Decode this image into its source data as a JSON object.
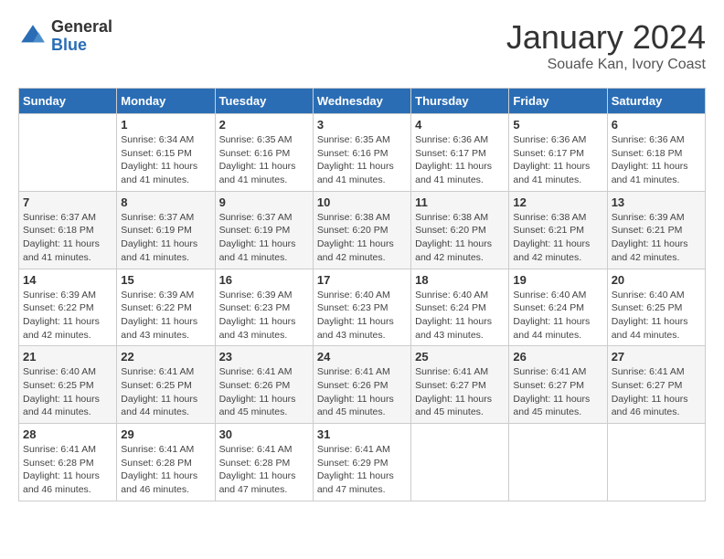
{
  "logo": {
    "general": "General",
    "blue": "Blue"
  },
  "title": {
    "month": "January 2024",
    "location": "Souafe Kan, Ivory Coast"
  },
  "weekdays": [
    "Sunday",
    "Monday",
    "Tuesday",
    "Wednesday",
    "Thursday",
    "Friday",
    "Saturday"
  ],
  "weeks": [
    [
      {
        "day": "",
        "info": ""
      },
      {
        "day": "1",
        "info": "Sunrise: 6:34 AM\nSunset: 6:15 PM\nDaylight: 11 hours and 41 minutes."
      },
      {
        "day": "2",
        "info": "Sunrise: 6:35 AM\nSunset: 6:16 PM\nDaylight: 11 hours and 41 minutes."
      },
      {
        "day": "3",
        "info": "Sunrise: 6:35 AM\nSunset: 6:16 PM\nDaylight: 11 hours and 41 minutes."
      },
      {
        "day": "4",
        "info": "Sunrise: 6:36 AM\nSunset: 6:17 PM\nDaylight: 11 hours and 41 minutes."
      },
      {
        "day": "5",
        "info": "Sunrise: 6:36 AM\nSunset: 6:17 PM\nDaylight: 11 hours and 41 minutes."
      },
      {
        "day": "6",
        "info": "Sunrise: 6:36 AM\nSunset: 6:18 PM\nDaylight: 11 hours and 41 minutes."
      }
    ],
    [
      {
        "day": "7",
        "info": "Sunrise: 6:37 AM\nSunset: 6:18 PM\nDaylight: 11 hours and 41 minutes."
      },
      {
        "day": "8",
        "info": "Sunrise: 6:37 AM\nSunset: 6:19 PM\nDaylight: 11 hours and 41 minutes."
      },
      {
        "day": "9",
        "info": "Sunrise: 6:37 AM\nSunset: 6:19 PM\nDaylight: 11 hours and 41 minutes."
      },
      {
        "day": "10",
        "info": "Sunrise: 6:38 AM\nSunset: 6:20 PM\nDaylight: 11 hours and 42 minutes."
      },
      {
        "day": "11",
        "info": "Sunrise: 6:38 AM\nSunset: 6:20 PM\nDaylight: 11 hours and 42 minutes."
      },
      {
        "day": "12",
        "info": "Sunrise: 6:38 AM\nSunset: 6:21 PM\nDaylight: 11 hours and 42 minutes."
      },
      {
        "day": "13",
        "info": "Sunrise: 6:39 AM\nSunset: 6:21 PM\nDaylight: 11 hours and 42 minutes."
      }
    ],
    [
      {
        "day": "14",
        "info": "Sunrise: 6:39 AM\nSunset: 6:22 PM\nDaylight: 11 hours and 42 minutes."
      },
      {
        "day": "15",
        "info": "Sunrise: 6:39 AM\nSunset: 6:22 PM\nDaylight: 11 hours and 43 minutes."
      },
      {
        "day": "16",
        "info": "Sunrise: 6:39 AM\nSunset: 6:23 PM\nDaylight: 11 hours and 43 minutes."
      },
      {
        "day": "17",
        "info": "Sunrise: 6:40 AM\nSunset: 6:23 PM\nDaylight: 11 hours and 43 minutes."
      },
      {
        "day": "18",
        "info": "Sunrise: 6:40 AM\nSunset: 6:24 PM\nDaylight: 11 hours and 43 minutes."
      },
      {
        "day": "19",
        "info": "Sunrise: 6:40 AM\nSunset: 6:24 PM\nDaylight: 11 hours and 44 minutes."
      },
      {
        "day": "20",
        "info": "Sunrise: 6:40 AM\nSunset: 6:25 PM\nDaylight: 11 hours and 44 minutes."
      }
    ],
    [
      {
        "day": "21",
        "info": "Sunrise: 6:40 AM\nSunset: 6:25 PM\nDaylight: 11 hours and 44 minutes."
      },
      {
        "day": "22",
        "info": "Sunrise: 6:41 AM\nSunset: 6:25 PM\nDaylight: 11 hours and 44 minutes."
      },
      {
        "day": "23",
        "info": "Sunrise: 6:41 AM\nSunset: 6:26 PM\nDaylight: 11 hours and 45 minutes."
      },
      {
        "day": "24",
        "info": "Sunrise: 6:41 AM\nSunset: 6:26 PM\nDaylight: 11 hours and 45 minutes."
      },
      {
        "day": "25",
        "info": "Sunrise: 6:41 AM\nSunset: 6:27 PM\nDaylight: 11 hours and 45 minutes."
      },
      {
        "day": "26",
        "info": "Sunrise: 6:41 AM\nSunset: 6:27 PM\nDaylight: 11 hours and 45 minutes."
      },
      {
        "day": "27",
        "info": "Sunrise: 6:41 AM\nSunset: 6:27 PM\nDaylight: 11 hours and 46 minutes."
      }
    ],
    [
      {
        "day": "28",
        "info": "Sunrise: 6:41 AM\nSunset: 6:28 PM\nDaylight: 11 hours and 46 minutes."
      },
      {
        "day": "29",
        "info": "Sunrise: 6:41 AM\nSunset: 6:28 PM\nDaylight: 11 hours and 46 minutes."
      },
      {
        "day": "30",
        "info": "Sunrise: 6:41 AM\nSunset: 6:28 PM\nDaylight: 11 hours and 47 minutes."
      },
      {
        "day": "31",
        "info": "Sunrise: 6:41 AM\nSunset: 6:29 PM\nDaylight: 11 hours and 47 minutes."
      },
      {
        "day": "",
        "info": ""
      },
      {
        "day": "",
        "info": ""
      },
      {
        "day": "",
        "info": ""
      }
    ]
  ]
}
